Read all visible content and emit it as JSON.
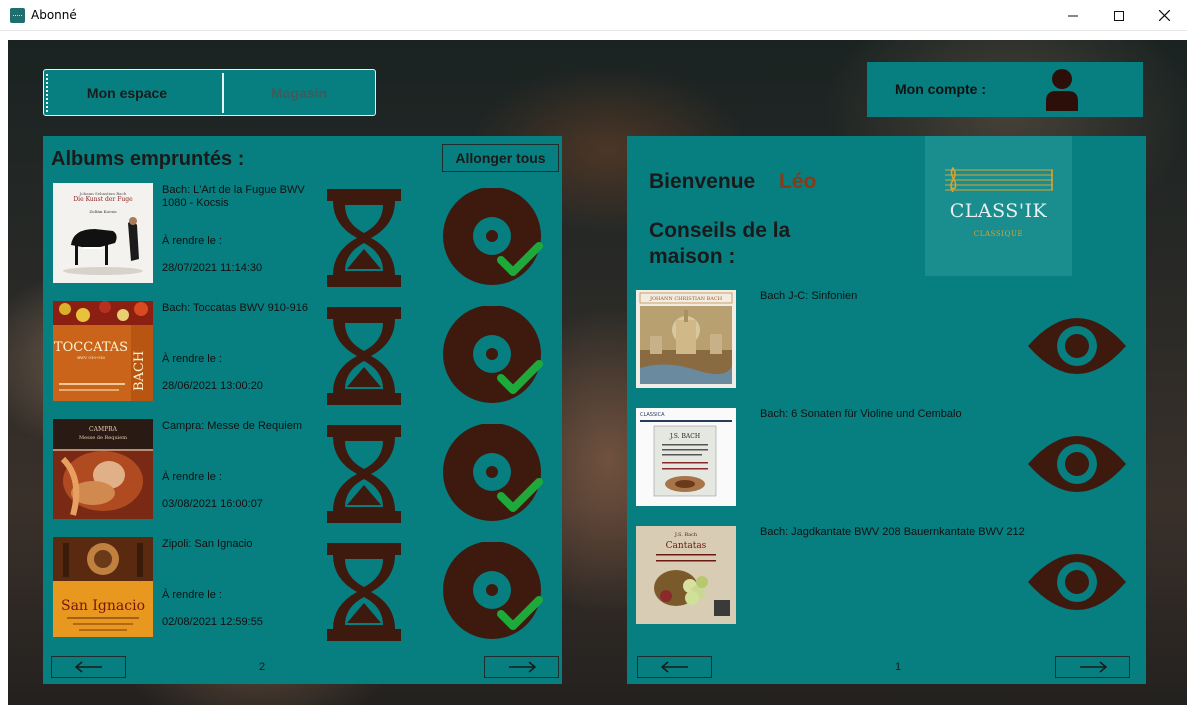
{
  "window": {
    "title": "Abonné",
    "minimize": "—",
    "maximize": "☐",
    "close": "✕"
  },
  "nav": {
    "tab_espace": "Mon espace",
    "tab_magasin": "Magasin"
  },
  "account": {
    "label": "Mon compte :",
    "icon": "user-icon"
  },
  "left": {
    "title": "Albums empruntés :",
    "extend_label": "Allonger tous",
    "page": "2",
    "prev_label": "⟵",
    "next_label": "⟶",
    "albums": [
      {
        "title": "Bach: L'Art de la Fugue BWV 1080 - Kocsis",
        "return_label": "À rendre le :",
        "date": "28/07/2021 11:14:30",
        "cover": {
          "top": "Johann Sebastian Bach",
          "name": "Die Kunst der Fuge",
          "sub": "Zoltán Kocsis"
        }
      },
      {
        "title": "Bach: Toccatas BWV 910-916",
        "return_label": "À rendre le :",
        "date": "28/06/2021 13:00:20",
        "cover": {
          "name": "TOCCATAS",
          "sub": "BWV 910-916",
          "side": "BACH"
        }
      },
      {
        "title": "Campra: Messe de Requiem",
        "return_label": "À rendre le :",
        "date": "03/08/2021 16:00:07",
        "cover": {
          "top": "CAMPRA",
          "sub": "Messe de Requiem"
        }
      },
      {
        "title": "Zipoli: San Ignacio",
        "return_label": "À rendre le :",
        "date": "02/08/2021 12:59:55",
        "cover": {
          "name": "San Ignacio"
        }
      }
    ]
  },
  "right": {
    "welcome": "Bienvenue",
    "user_name": "Léo",
    "advice": "Conseils de la maison :",
    "logo_name": "CLASS'IK",
    "logo_sub": "CLASSIQUE",
    "page": "1",
    "prev_label": "⟵",
    "next_label": "⟶",
    "recommendations": [
      {
        "title": "Bach J-C: Sinfonien",
        "cover": {
          "top": "JOHANN CHRISTIAN BACH"
        }
      },
      {
        "title": "Bach: 6 Sonaten für Violine und Cembalo",
        "cover": {
          "top": "CLASSICA",
          "name": "J.S. BACH"
        }
      },
      {
        "title": "Bach: Jagdkantate BWV 208  Bauernkantate BWV 212",
        "cover": {
          "top": "J.S. Bach",
          "name": "Cantatas"
        }
      }
    ]
  },
  "colors": {
    "teal": "#077e80",
    "brown": "#3e1a0e",
    "check": "#1eaa3a",
    "accent_name": "#8a3a14",
    "gold": "#d9a531"
  }
}
